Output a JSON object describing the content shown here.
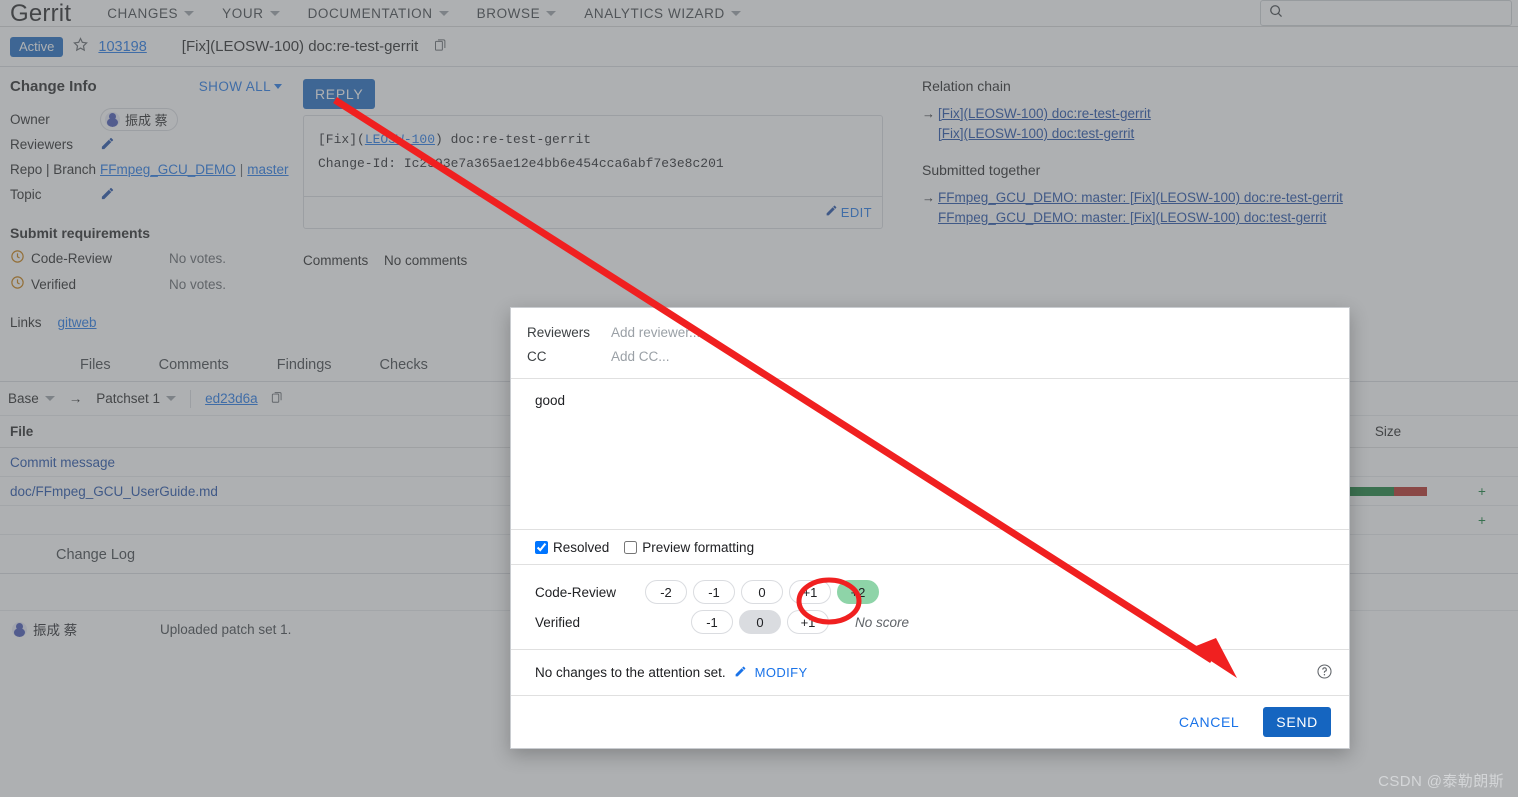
{
  "navbar": {
    "brand": "Gerrit",
    "items": [
      {
        "label": "CHANGES",
        "has_caret": true
      },
      {
        "label": "YOUR",
        "has_caret": true
      },
      {
        "label": "DOCUMENTATION",
        "has_caret": true
      },
      {
        "label": "BROWSE",
        "has_caret": true
      },
      {
        "label": "ANALYTICS WIZARD",
        "has_caret": true
      }
    ],
    "search_placeholder": "",
    "search_value": ""
  },
  "change_header": {
    "status_badge": "Active",
    "change_number": "103198",
    "title": "[Fix](LEOSW-100) doc:re-test-gerrit"
  },
  "change_info": {
    "title": "Change Info",
    "show_all": "SHOW ALL",
    "rows": [
      {
        "key": "Owner",
        "value": "振成 蔡",
        "type": "chip"
      },
      {
        "key": "Reviewers",
        "value": "",
        "type": "edit"
      },
      {
        "key": "Repo | Branch",
        "repo": "FFmpeg_GCU_DEMO",
        "separator": "|",
        "branch": "master",
        "type": "links"
      },
      {
        "key": "Topic",
        "value": "",
        "type": "edit"
      }
    ],
    "submit_requirements": {
      "title": "Submit requirements",
      "items": [
        {
          "name": "Code-Review",
          "status": "No votes."
        },
        {
          "name": "Verified",
          "status": "No votes."
        }
      ]
    },
    "links": {
      "label": "Links",
      "items": [
        "gitweb"
      ]
    }
  },
  "main": {
    "reply_button": "REPLY",
    "commit_message": "[Fix](LEOSW-100) doc:re-test-gerrit\n\nChange-Id: Ic2393e7a365ae12e4bb6e454cca6abf7e3e8c201",
    "commit_line1_prefix": "[Fix](",
    "commit_line1_link": "LEOSW-100",
    "commit_line1_suffix": ") doc:re-test-gerrit",
    "commit_line2": "Change-Id: Ic2393e7a365ae12e4bb6e454cca6abf7e3e8c201",
    "edit_label": "EDIT",
    "comments_label": "Comments",
    "comments_value": "No comments"
  },
  "relation": {
    "chain_title": "Relation chain",
    "chain_items": [
      "[Fix](LEOSW-100) doc:re-test-gerrit",
      "[Fix](LEOSW-100) doc:test-gerrit"
    ],
    "submitted_title": "Submitted together",
    "submitted_items": [
      "FFmpeg_GCU_DEMO: master: [Fix](LEOSW-100) doc:re-test-gerrit",
      "FFmpeg_GCU_DEMO: master: [Fix](LEOSW-100) doc:test-gerrit"
    ]
  },
  "tabs": [
    {
      "label": "Files"
    },
    {
      "label": "Comments"
    },
    {
      "label": "Findings"
    },
    {
      "label": "Checks"
    }
  ],
  "patchset_row": {
    "base": "Base",
    "arrow": "→",
    "patchset": "Patchset 1",
    "revision": "ed23d6a"
  },
  "files_table": {
    "headers": {
      "file": "File",
      "size": "Size",
      "delta": ""
    },
    "rows": [
      {
        "file": "Commit message",
        "add_pct": 0,
        "del_pct": 0,
        "delta": "",
        "has_bar": false
      },
      {
        "file": "doc/FFmpeg_GCU_UserGuide.md",
        "add_pct": 50,
        "del_pct": 50,
        "delta": "+",
        "has_bar": true
      },
      {
        "file": "",
        "add_pct": 0,
        "del_pct": 0,
        "delta": "+",
        "has_bar": false
      }
    ]
  },
  "change_log": {
    "title": "Change Log",
    "entries": [
      {
        "author": "振成 蔡",
        "message": "Uploaded patch set 1."
      }
    ]
  },
  "reply_dialog": {
    "reviewers_label": "Reviewers",
    "reviewers_placeholder": "Add reviewer...",
    "cc_label": "CC",
    "cc_placeholder": "Add CC...",
    "message_value": "good",
    "resolved_label": "Resolved",
    "resolved_checked": true,
    "preview_label": "Preview formatting",
    "preview_checked": false,
    "labels": [
      {
        "name": "Code-Review",
        "options": [
          "-2",
          "-1",
          "0",
          "+1",
          "+2"
        ],
        "selected": "+2",
        "selected_style": "max",
        "score_text": ""
      },
      {
        "name": "Verified",
        "options": [
          "-1",
          "0",
          "+1"
        ],
        "selected": "0",
        "selected_style": "neutral",
        "score_text": "No score"
      }
    ],
    "attention_text": "No changes to the attention set.",
    "modify_label": "MODIFY",
    "cancel_label": "CANCEL",
    "send_label": "SEND"
  },
  "colors": {
    "accent_blue": "#1565c0",
    "link_blue": "#1a73e8",
    "vote_max_green": "#8ed4a8",
    "vote_neutral_gray": "#dadce0",
    "diff_add_green": "#0f7b33",
    "diff_del_red": "#b3261e",
    "annotation_red": "#f02020",
    "scrim": "rgba(100,103,107,0.52)"
  },
  "watermark": "CSDN @泰勒朗斯"
}
